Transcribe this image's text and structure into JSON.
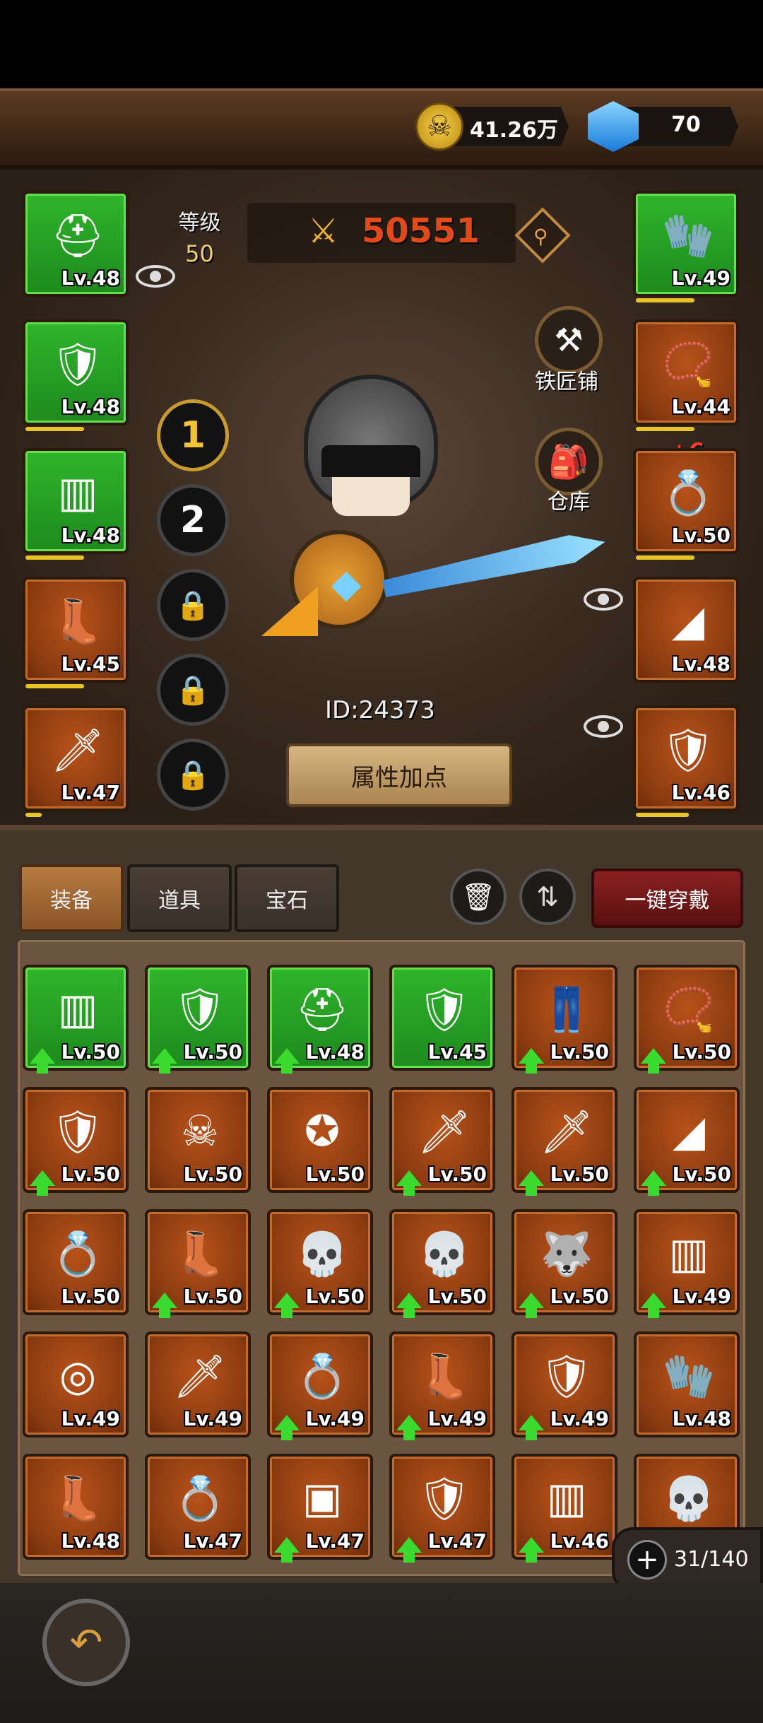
{
  "currency": {
    "gold": "41.26万",
    "gems": "70"
  },
  "hero": {
    "level_label": "等级",
    "level_value": "50",
    "power": "50551",
    "id_text": "ID:24373",
    "attr_button": "属性加点",
    "blacksmith_label": "铁匠铺",
    "warehouse_label": "仓库",
    "ring_bonus": "+6",
    "loadouts": [
      "1",
      "2"
    ]
  },
  "equipped_left": [
    {
      "lv": "Lv.48",
      "icon": "helmet",
      "rarity": "green",
      "bar": 0
    },
    {
      "lv": "Lv.48",
      "icon": "chest-armor",
      "rarity": "green",
      "bar": 0.55
    },
    {
      "lv": "Lv.48",
      "icon": "leg-armor",
      "rarity": "green",
      "bar": 0.55
    },
    {
      "lv": "Lv.45",
      "icon": "boots",
      "rarity": "brown",
      "bar": 0.55
    },
    {
      "lv": "Lv.47",
      "icon": "sword",
      "rarity": "brown",
      "bar": 0.15
    }
  ],
  "equipped_right": [
    {
      "lv": "Lv.49",
      "icon": "gloves",
      "rarity": "green",
      "bar": 0.55
    },
    {
      "lv": "Lv.44",
      "icon": "necklace",
      "rarity": "brown",
      "bar": 0.55
    },
    {
      "lv": "Lv.50",
      "icon": "ring",
      "rarity": "brown",
      "bar": 0.55
    },
    {
      "lv": "Lv.48",
      "icon": "cape",
      "rarity": "brown",
      "bar": 0
    },
    {
      "lv": "Lv.46",
      "icon": "shield",
      "rarity": "brown",
      "bar": 0.5
    }
  ],
  "tabs": [
    "装备",
    "道具",
    "宝石"
  ],
  "oneclick_label": "一键穿戴",
  "capacity": "31/140",
  "inventory": [
    {
      "lv": "Lv.50",
      "icon": "leg-armor",
      "rarity": "green",
      "up": true
    },
    {
      "lv": "Lv.50",
      "icon": "chest-armor",
      "rarity": "green",
      "up": true
    },
    {
      "lv": "Lv.48",
      "icon": "helmet",
      "rarity": "green",
      "up": true
    },
    {
      "lv": "Lv.45",
      "icon": "chest-armor",
      "rarity": "green",
      "up": false
    },
    {
      "lv": "Lv.50",
      "icon": "pants",
      "rarity": "brown",
      "up": true
    },
    {
      "lv": "Lv.50",
      "icon": "necklace",
      "rarity": "brown",
      "up": true
    },
    {
      "lv": "Lv.50",
      "icon": "shield",
      "rarity": "brown",
      "up": true
    },
    {
      "lv": "Lv.50",
      "icon": "skull-shield",
      "rarity": "brown",
      "up": false
    },
    {
      "lv": "Lv.50",
      "icon": "star-shield",
      "rarity": "brown",
      "up": false
    },
    {
      "lv": "Lv.50",
      "icon": "fire-sword",
      "rarity": "brown",
      "up": true
    },
    {
      "lv": "Lv.50",
      "icon": "sword",
      "rarity": "brown",
      "up": true
    },
    {
      "lv": "Lv.50",
      "icon": "cape",
      "rarity": "brown",
      "up": true
    },
    {
      "lv": "Lv.50",
      "icon": "ring",
      "rarity": "brown",
      "up": false
    },
    {
      "lv": "Lv.50",
      "icon": "boots",
      "rarity": "brown",
      "up": true
    },
    {
      "lv": "Lv.50",
      "icon": "skull-helmet",
      "rarity": "brown",
      "up": true
    },
    {
      "lv": "Lv.50",
      "icon": "skull-helmet",
      "rarity": "brown",
      "up": true
    },
    {
      "lv": "Lv.50",
      "icon": "wolf-helmet",
      "rarity": "brown",
      "up": true
    },
    {
      "lv": "Lv.49",
      "icon": "leg-armor",
      "rarity": "brown",
      "up": true
    },
    {
      "lv": "Lv.49",
      "icon": "wood-shield",
      "rarity": "brown",
      "up": false
    },
    {
      "lv": "Lv.49",
      "icon": "sabre",
      "rarity": "brown",
      "up": false
    },
    {
      "lv": "Lv.49",
      "icon": "ring",
      "rarity": "brown",
      "up": true
    },
    {
      "lv": "Lv.49",
      "icon": "boots",
      "rarity": "brown",
      "up": true
    },
    {
      "lv": "Lv.49",
      "icon": "chest-armor",
      "rarity": "brown",
      "up": true
    },
    {
      "lv": "Lv.48",
      "icon": "gloves",
      "rarity": "brown",
      "up": false
    },
    {
      "lv": "Lv.48",
      "icon": "boots",
      "rarity": "brown",
      "up": false
    },
    {
      "lv": "Lv.47",
      "icon": "ring",
      "rarity": "brown",
      "up": false
    },
    {
      "lv": "Lv.47",
      "icon": "bracers",
      "rarity": "brown",
      "up": true
    },
    {
      "lv": "Lv.47",
      "icon": "chest-armor",
      "rarity": "brown",
      "up": true
    },
    {
      "lv": "Lv.46",
      "icon": "leg-armor",
      "rarity": "brown",
      "up": true
    },
    {
      "lv": "",
      "icon": "skull-ring",
      "rarity": "brown",
      "up": false
    }
  ]
}
